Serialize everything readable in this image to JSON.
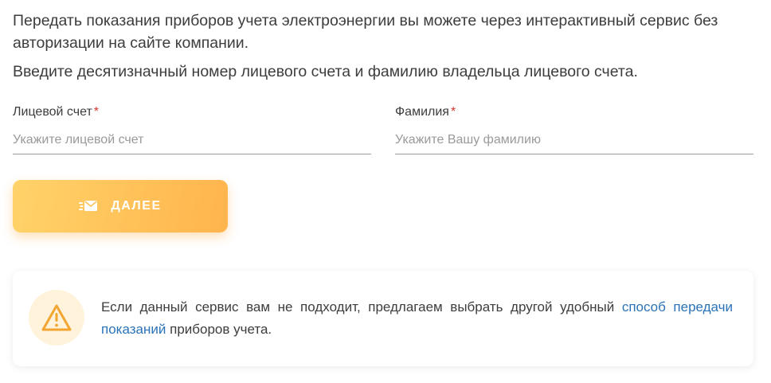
{
  "intro": {
    "line1": "Передать показания приборов учета электроэнергии вы можете через интерактивный сервис без авторизации на сайте компании.",
    "line2": "Введите десятизначный номер лицевого счета и фамилию владельца лицевого счета."
  },
  "form": {
    "account": {
      "label": "Лицевой счет",
      "required_mark": "*",
      "placeholder": "Укажите лицевой счет",
      "value": ""
    },
    "surname": {
      "label": "Фамилия",
      "required_mark": "*",
      "placeholder": "Укажите Вашу фамилию",
      "value": ""
    },
    "next_button": {
      "label": "ДАЛЕЕ",
      "icon": "send-envelope-icon"
    }
  },
  "notice": {
    "icon": "warning-icon",
    "text_before": "Если данный сервис вам не подходит, предлагаем выбрать другой удобный",
    "link_text": "способ передачи показаний",
    "text_after": "приборов учета."
  },
  "colors": {
    "button_gradient_start": "#ffd36a",
    "button_gradient_end": "#ffb44c",
    "required": "#d33a2c",
    "link": "#2a73b8",
    "warning": "#f2a531",
    "warning_bg": "#fff3dc"
  }
}
